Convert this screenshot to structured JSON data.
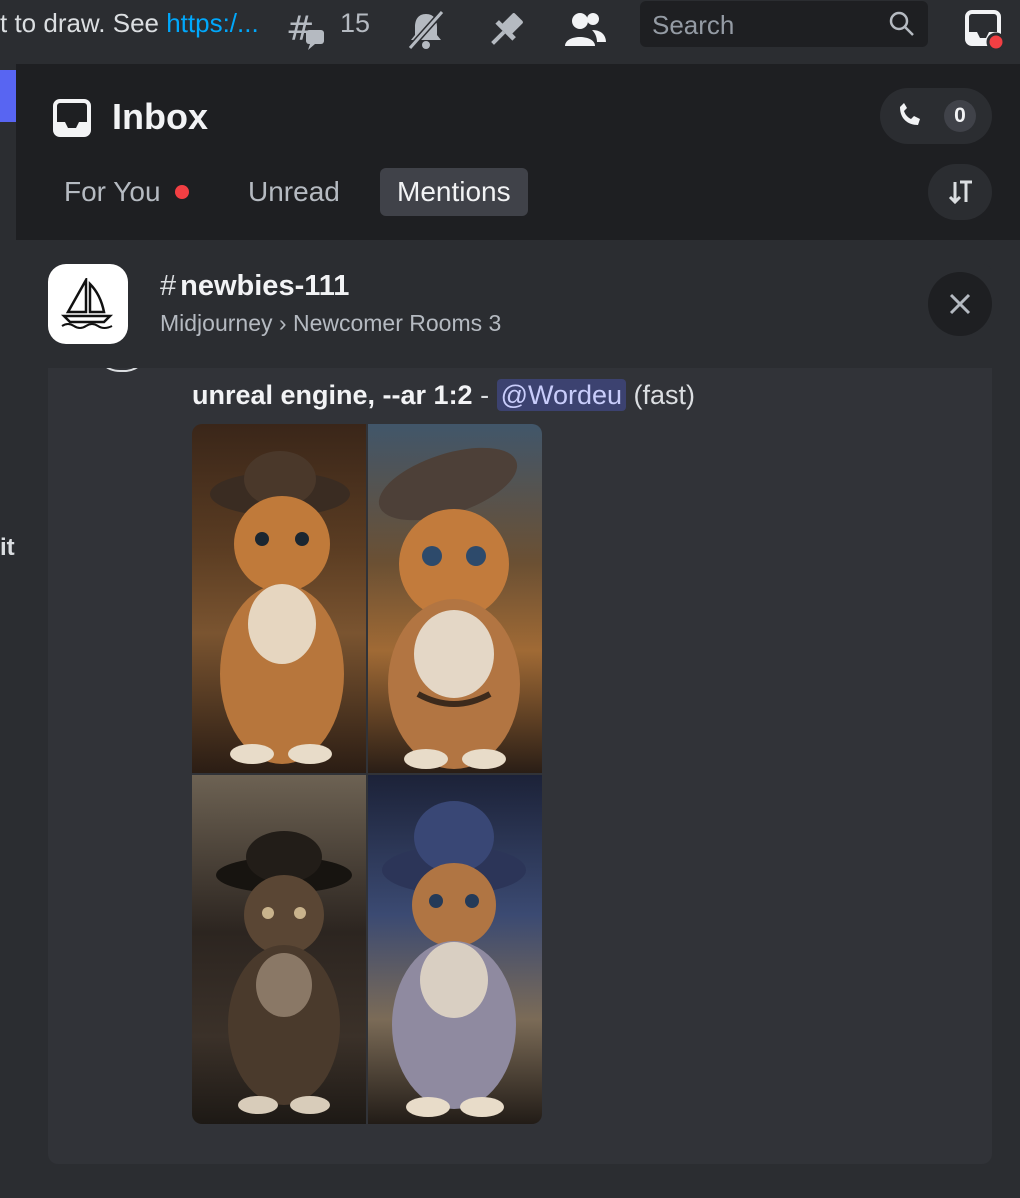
{
  "topbar": {
    "topic_prefix": "t to draw. See ",
    "topic_link": "https:/...",
    "thread_count": "15",
    "search_placeholder": "Search",
    "icons": [
      "threads-icon",
      "mute-bell-icon",
      "pin-icon",
      "members-icon",
      "search-icon",
      "inbox-icon"
    ]
  },
  "leftstrip": {
    "fragment": "it"
  },
  "inbox": {
    "title": "Inbox",
    "calls_count": "0",
    "tabs": [
      {
        "label": "For You",
        "active": false,
        "has_dot": true
      },
      {
        "label": "Unread",
        "active": false
      },
      {
        "label": "Mentions",
        "active": true
      }
    ]
  },
  "card": {
    "channel_name": "newbies-111",
    "server": "Midjourney",
    "separator": "›",
    "category": "Newcomer Rooms 3",
    "message": {
      "text_bold": "unreal engine, --ar 1:2",
      "dash": " - ",
      "mention": "@Wordeu",
      "suffix": " (fast)"
    },
    "image_grid": {
      "description_cells": [
        "kitten-with-hat-1",
        "kitten-with-hat-2",
        "kitten-with-hat-3",
        "kitten-with-hat-4"
      ]
    }
  },
  "colors": {
    "accent": "#5865f2",
    "unread_dot": "#f23f43",
    "link": "#00a8fc",
    "mention_bg": "#3c4270"
  }
}
